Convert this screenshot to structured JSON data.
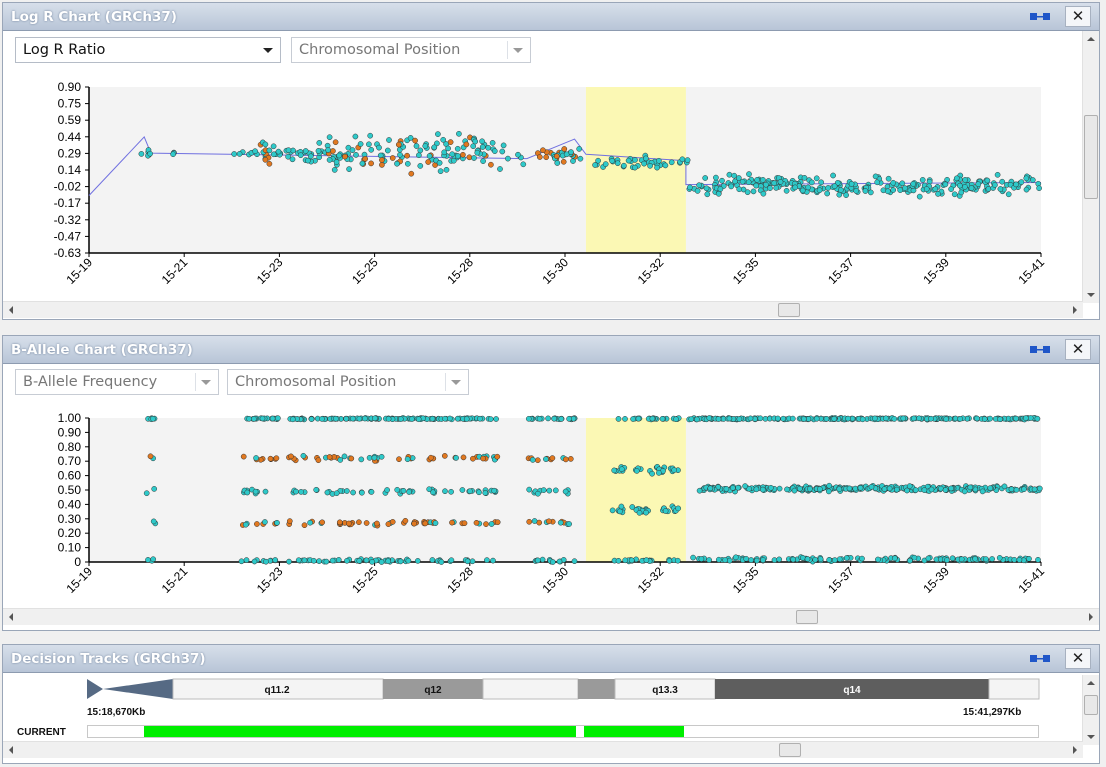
{
  "colors": {
    "highlight": "#fbf8b4",
    "cyan": "#2ec9c9",
    "orange": "#e07820",
    "plot_bg": "#f3f3f3",
    "band_green": "#00ee00"
  },
  "logr_panel": {
    "title": "Log R Chart (GRCh37)",
    "metric_dropdown": "Log R Ratio",
    "position_dropdown": "Chromosomal Position",
    "chart_data": {
      "type": "scatter",
      "y_ticks": [
        "0.90",
        "0.75",
        "0.59",
        "0.44",
        "0.29",
        "0.14",
        "-0.02",
        "-0.17",
        "-0.32",
        "-0.47",
        "-0.63"
      ],
      "x_ticks": [
        "15-19",
        "15-21",
        "15-23",
        "15-25",
        "15-28",
        "15-30",
        "15-32",
        "15-35",
        "15-37",
        "15-39",
        "15-41"
      ],
      "ylim": [
        -0.63,
        0.9
      ],
      "series": [
        {
          "x_range": [
            "15-19",
            "15-20"
          ],
          "level": -0.1
        },
        {
          "x_range": [
            "15-20",
            "15-30"
          ],
          "level": 0.29
        },
        {
          "x_range": [
            "15-30",
            "15-33"
          ],
          "level": 0.22
        },
        {
          "x_range": [
            "15-33",
            "15-41"
          ],
          "level": 0.0
        }
      ],
      "highlight_region": [
        "15-30.5",
        "15-32.5"
      ]
    }
  },
  "baf_panel": {
    "title": "B-Allele Chart (GRCh37)",
    "metric_dropdown": "B-Allele Frequency",
    "position_dropdown": "Chromosomal Position",
    "chart_data": {
      "type": "scatter",
      "y_ticks": [
        "1.00",
        "0.90",
        "0.80",
        "0.70",
        "0.60",
        "0.50",
        "0.40",
        "0.30",
        "0.20",
        "0.10",
        "0"
      ],
      "x_ticks": [
        "15-19",
        "15-21",
        "15-23",
        "15-25",
        "15-28",
        "15-30",
        "15-32",
        "15-35",
        "15-37",
        "15-39",
        "15-41"
      ],
      "ylim": [
        0,
        1
      ],
      "bands_region_a": [
        0.0,
        0.25,
        0.5,
        0.72,
        1.0
      ],
      "bands_region_b": [
        0.0,
        0.35,
        0.65,
        1.0
      ],
      "bands_region_c": [
        0.0,
        0.5,
        1.0
      ],
      "highlight_region": [
        "15-30.5",
        "15-32.5"
      ]
    }
  },
  "decision_panel": {
    "title": "Decision Tracks (GRCh37)",
    "bands": [
      "q11.2",
      "q12",
      "q13.3",
      "q14"
    ],
    "start_label": "15:18,670Kb",
    "end_label": "15:41,297Kb",
    "track_label": "CURRENT"
  }
}
